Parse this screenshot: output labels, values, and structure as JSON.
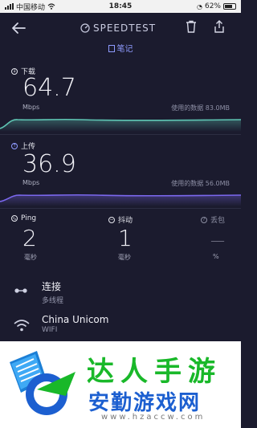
{
  "status_bar": {
    "carrier": "中国移动",
    "time": "18:45",
    "battery": "62%"
  },
  "header": {
    "title": "SPEEDTEST",
    "notes_label": "笔记"
  },
  "download": {
    "label": "下载",
    "value": "64.7",
    "unit": "Mbps",
    "used": "使用的数据 83.0MB"
  },
  "upload": {
    "label": "上传",
    "value": "36.9",
    "unit": "Mbps",
    "used": "使用的数据 56.0MB"
  },
  "stats": [
    {
      "label": "Ping",
      "value": "2",
      "unit": "毫秒"
    },
    {
      "label": "抖动",
      "value": "1",
      "unit": "毫秒"
    },
    {
      "label": "丢包",
      "value": "—",
      "unit": "%"
    }
  ],
  "connections": {
    "title": "连接",
    "subtitle": "多线程"
  },
  "network": {
    "title": "China Unicom",
    "subtitle": "WIFI"
  },
  "watermark": {
    "top": "达人手游",
    "main": "安勤游戏网",
    "url": "www.hzaccw.com"
  },
  "colors": {
    "download_line": "#5fc6b4",
    "upload_line": "#7b68ee",
    "notes_accent": "#8f9bff",
    "brand_green": "#19b829",
    "brand_blue": "#1c5fd0"
  }
}
